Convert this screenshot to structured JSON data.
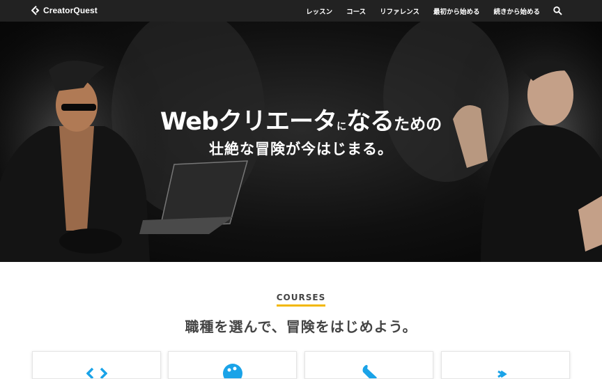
{
  "nav": {
    "logo_text": "CreatorQuest",
    "links": [
      "レッスン",
      "コース",
      "リファレンス",
      "最初から始める",
      "続きから始める"
    ],
    "search_icon": "search-icon"
  },
  "hero": {
    "title_part1": "Webクリエータ",
    "title_part2": "に",
    "title_part3": "なる",
    "title_part4": "ための",
    "subtitle": "壮絶な冒険が今はじまる。"
  },
  "courses": {
    "label": "COURSES",
    "heading": "職種を選んで、冒険をはじめよう。",
    "cards": [
      {
        "icon": "code-icon"
      },
      {
        "icon": "palette-icon"
      },
      {
        "icon": "wrench-icon"
      },
      {
        "icon": "terminal-icon"
      }
    ]
  },
  "colors": {
    "nav_bg": "#222222",
    "accent": "#f2b701",
    "icon_blue": "#1aa3e8",
    "heading": "#444444"
  }
}
